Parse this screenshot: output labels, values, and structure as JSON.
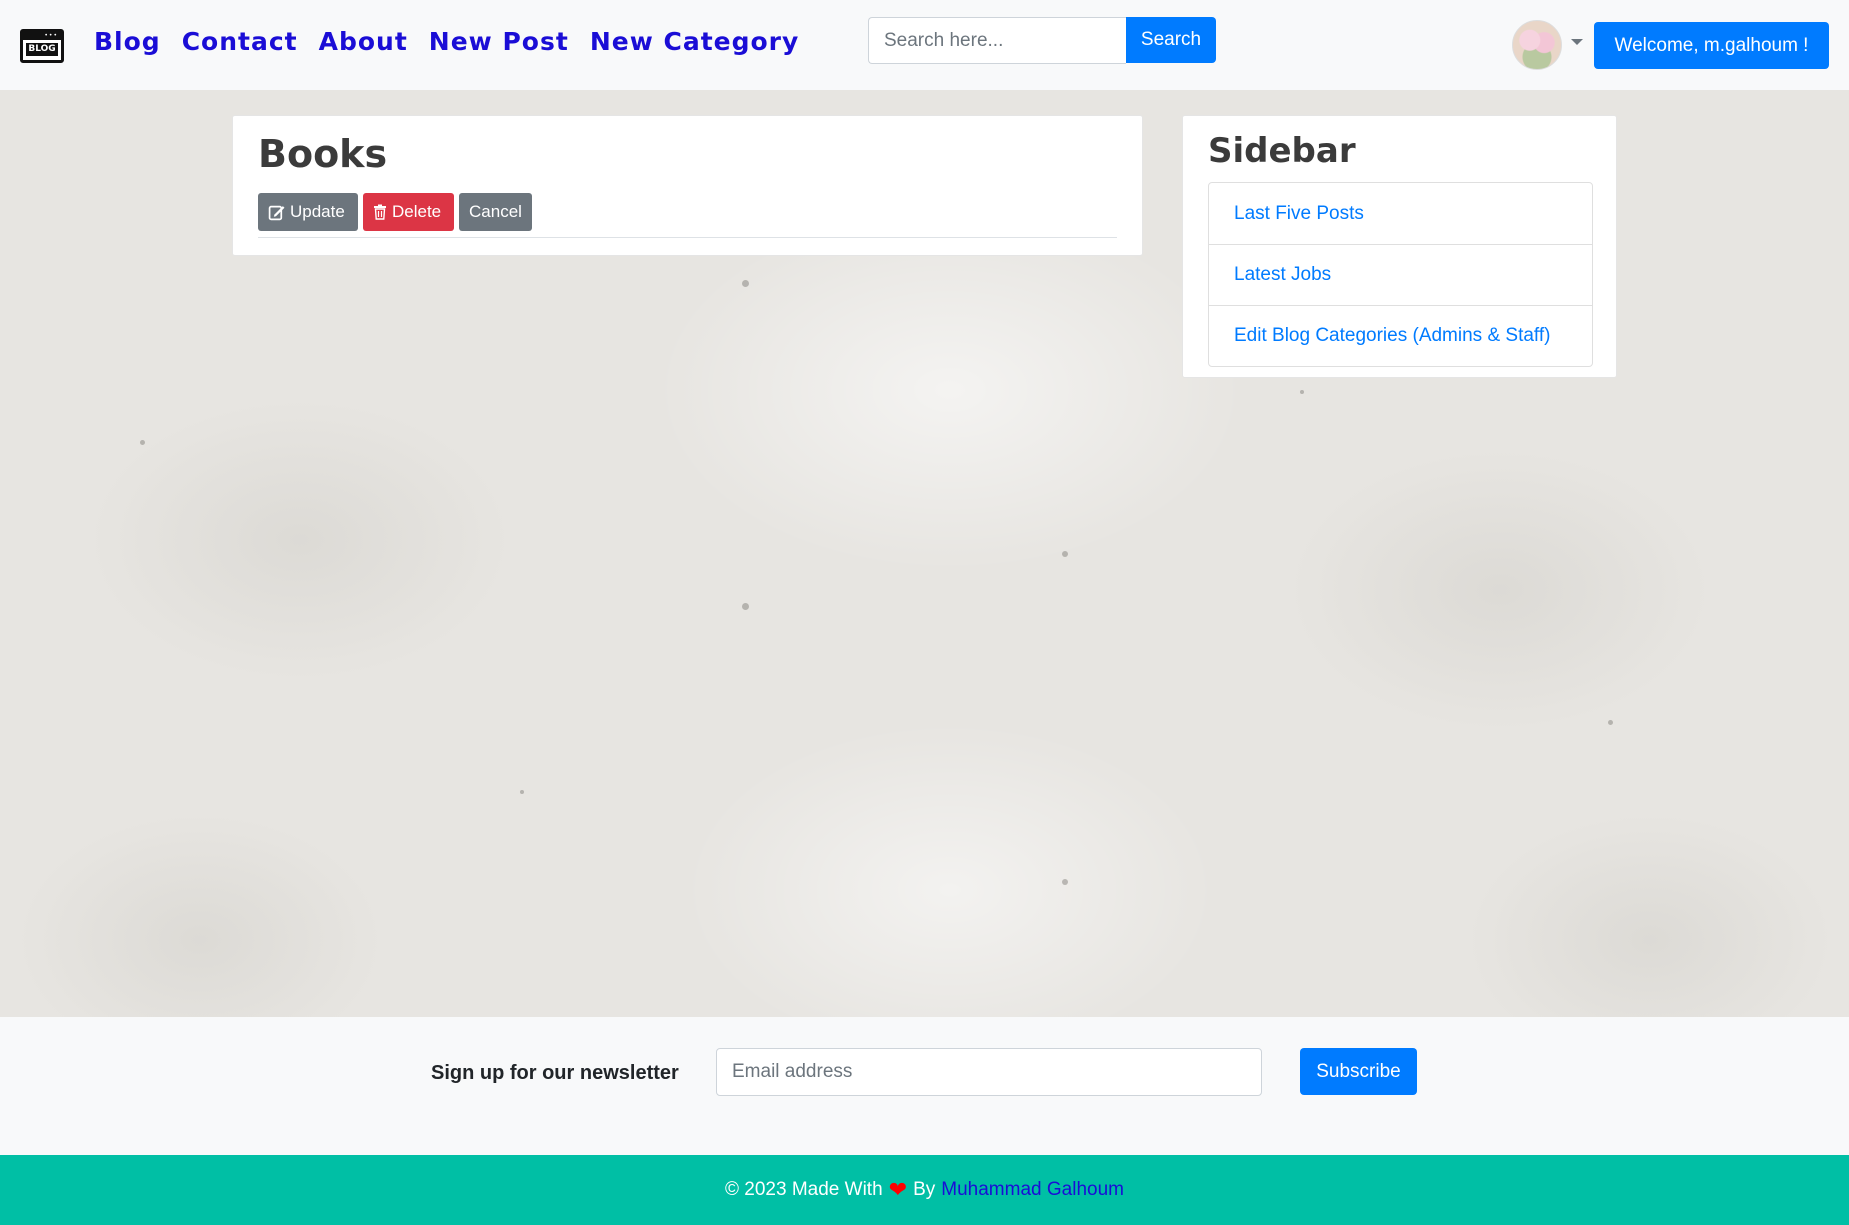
{
  "navbar": {
    "logo_text": "BLOG",
    "links": [
      "Blog",
      "Contact",
      "About",
      "New Post",
      "New Category"
    ],
    "search": {
      "placeholder": "Search here...",
      "button_label": "Search"
    },
    "welcome_label": "Welcome, m.galhoum !"
  },
  "main": {
    "title": "Books",
    "buttons": {
      "update": "Update",
      "delete": "Delete",
      "cancel": "Cancel"
    }
  },
  "sidebar": {
    "title": "Sidebar",
    "items": [
      "Last Five Posts",
      "Latest Jobs",
      "Edit Blog Categories (Admins & Staff)"
    ]
  },
  "newsletter": {
    "label": "Sign up for our newsletter",
    "email_placeholder": "Email address",
    "button_label": "Subscribe"
  },
  "footer": {
    "text_prefix": "© 2023 Made With",
    "text_by": "By",
    "author": "Muhammad Galhoum"
  },
  "colors": {
    "primary": "#007bff",
    "nav_link": "#1a0dd6",
    "danger": "#dc3545",
    "secondary": "#6c757d",
    "footer_bg": "#00bfa5"
  }
}
